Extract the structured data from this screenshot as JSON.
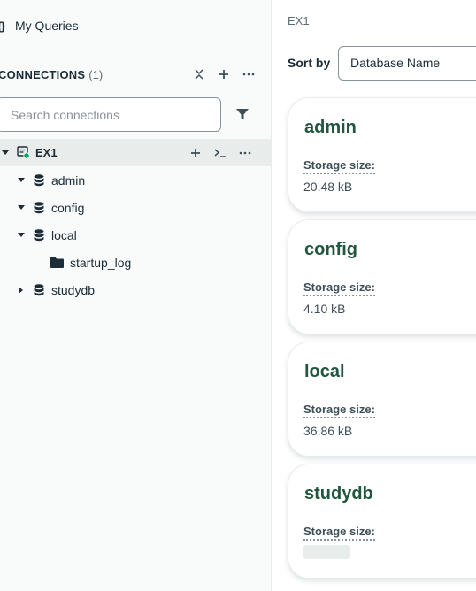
{
  "sidebar": {
    "my_queries": "My Queries",
    "connections_title": "CONNECTIONS",
    "connections_count": "(1)",
    "search_placeholder": "Search connections",
    "tree": {
      "connection": "EX1",
      "databases": [
        {
          "label": "admin"
        },
        {
          "label": "config"
        },
        {
          "label": "local"
        },
        {
          "label": "studydb"
        }
      ],
      "collection": "startup_log"
    }
  },
  "main": {
    "breadcrumb": "EX1",
    "sort_label": "Sort by",
    "sort_value": "Database Name",
    "storage_label": "Storage size:",
    "cards": [
      {
        "name": "admin",
        "storage": "20.48 kB"
      },
      {
        "name": "config",
        "storage": "4.10 kB"
      },
      {
        "name": "local",
        "storage": "36.86 kB"
      },
      {
        "name": "studydb",
        "storage": ""
      }
    ]
  },
  "colors": {
    "accent_green": "#21563f",
    "status_dot": "#00a35c",
    "sidebar_bg": "#f9fbfa",
    "selected_bg": "#e8edeb"
  },
  "icons": [
    "braces-icon",
    "collapse-all-icon",
    "plus-icon",
    "ellipsis-icon",
    "filter-icon",
    "connection-icon",
    "shell-icon",
    "database-icon",
    "folder-icon",
    "caret-down-icon",
    "caret-right-icon"
  ]
}
